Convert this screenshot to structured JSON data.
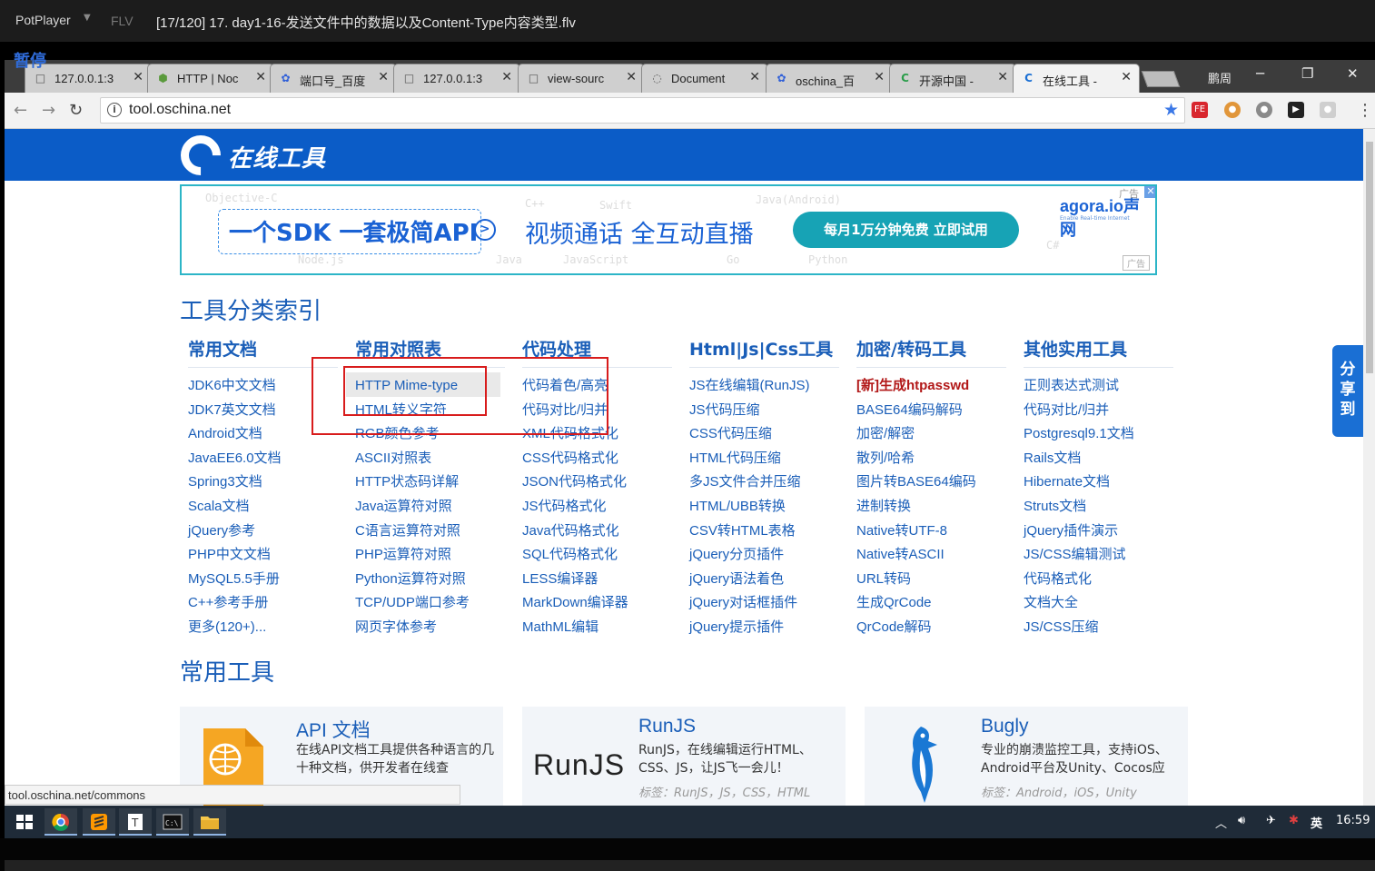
{
  "player": {
    "brand": "PotPlayer",
    "format": "FLV",
    "file": "[17/120] 17. day1-16-发送文件中的数据以及Content-Type内容类型.flv",
    "pause_label": "暂停"
  },
  "browser": {
    "tabs": [
      {
        "label": "127.0.0.1:3",
        "icon": "page-icon"
      },
      {
        "label": "HTTP | Noc",
        "icon": "node-icon"
      },
      {
        "label": "端口号_百度",
        "icon": "baidu-icon"
      },
      {
        "label": "127.0.0.1:3",
        "icon": "page-icon"
      },
      {
        "label": "view-sourc",
        "icon": "page-icon"
      },
      {
        "label": "Document",
        "icon": "loading-icon"
      },
      {
        "label": "oschina_百",
        "icon": "baidu-icon"
      },
      {
        "label": "开源中国 -",
        "icon": "oschina-icon"
      },
      {
        "label": "在线工具 -",
        "icon": "oschina-icon"
      }
    ],
    "profile": "鹏周",
    "url": "tool.oschina.net",
    "status_url": "tool.oschina.net/commons"
  },
  "site": {
    "logo_text": "在线工具",
    "ad": {
      "sdk_text": "一个SDK 一套极简API",
      "video_text": "视频通话 全互动直播",
      "cta": "每月1万分钟免费 立即试用",
      "brand": "agora.io声网",
      "brand_sub": "Enable Real-time Internet",
      "tag": "广告",
      "code_words": [
        "Objective-C",
        "C++",
        "Swift",
        "Java(Android)",
        "Node.js",
        "Java",
        "JavaScript",
        "Go",
        "Python",
        "C#"
      ]
    },
    "index_title": "工具分类索引",
    "columns": [
      {
        "title": "常用文档",
        "items": [
          "JDK6中文文档",
          "JDK7英文文档",
          "Android文档",
          "JavaEE6.0文档",
          "Spring3文档",
          "Scala文档",
          "jQuery参考",
          "PHP中文文档",
          "MySQL5.5手册",
          "C++参考手册",
          "更多(120+)..."
        ]
      },
      {
        "title": "常用对照表",
        "items": [
          "HTTP Mime-type",
          "HTML转义字符",
          "RGB颜色参考",
          "ASCII对照表",
          "HTTP状态码详解",
          "Java运算符对照",
          "C语言运算符对照",
          "PHP运算符对照",
          "Python运算符对照",
          "TCP/UDP端口参考",
          "网页字体参考"
        ]
      },
      {
        "title": "代码处理",
        "items": [
          "代码着色/高亮",
          "代码对比/归并",
          "XML代码格式化",
          "CSS代码格式化",
          "JSON代码格式化",
          "JS代码格式化",
          "Java代码格式化",
          "SQL代码格式化",
          "LESS编译器",
          "MarkDown编译器",
          "MathML编辑"
        ]
      },
      {
        "title": "Html|Js|Css工具",
        "items": [
          "JS在线编辑(RunJS)",
          "JS代码压缩",
          "CSS代码压缩",
          "HTML代码压缩",
          "多JS文件合并压缩",
          "HTML/UBB转换",
          "CSV转HTML表格",
          "jQuery分页插件",
          "jQuery语法着色",
          "jQuery对话框插件",
          "jQuery提示插件"
        ]
      },
      {
        "title": "加密/转码工具",
        "items": [
          "[新]生成htpasswd",
          "BASE64编码解码",
          "加密/解密",
          "散列/哈希",
          "图片转BASE64编码",
          "进制转换",
          "Native转UTF-8",
          "Native转ASCII",
          "URL转码",
          "生成QrCode",
          "QrCode解码"
        ]
      },
      {
        "title": "其他实用工具",
        "items": [
          "正则表达式测试",
          "代码对比/归并",
          "Postgresql9.1文档",
          "Rails文档",
          "Hibernate文档",
          "Struts文档",
          "jQuery插件演示",
          "JS/CSS编辑测试",
          "代码格式化",
          "文档大全",
          "JS/CSS压缩"
        ]
      }
    ],
    "common_title": "常用工具",
    "cards": [
      {
        "title": "API 文档",
        "desc": "在线API文档工具提供各种语言的几十种文档，供开发者在线查",
        "tags": ""
      },
      {
        "title": "RunJS",
        "desc": "RunJS，在线编辑运行HTML、CSS、JS，让JS飞一会儿！",
        "tags": "标签：RunJS，JS，CSS，HTML",
        "logo": "RunJS"
      },
      {
        "title": "Bugly",
        "desc": "专业的崩溃监控工具，支持iOS、Android平台及Unity、Cocos应",
        "tags": "标签：Android，iOS，Unity"
      }
    ],
    "share_text": [
      "分",
      "享",
      "到"
    ]
  },
  "taskbar": {
    "tray_ime": "英",
    "clock": "16:59"
  },
  "colors": {
    "link": "#1a5eb8",
    "header": "#0b5cc7",
    "highlight_box": "#d81c1c"
  }
}
